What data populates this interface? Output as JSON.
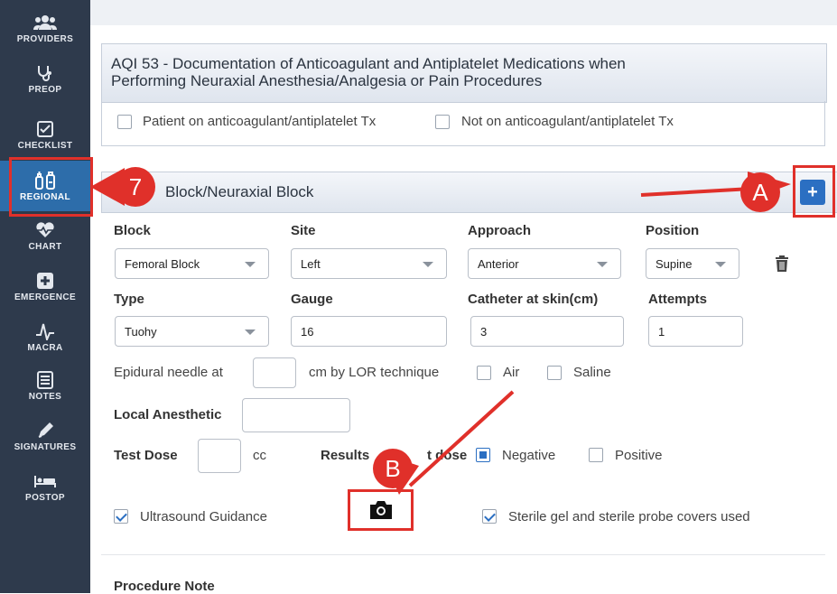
{
  "sidebar": {
    "items": [
      {
        "label": "PROVIDERS",
        "icon": "providers-icon"
      },
      {
        "label": "PREOP",
        "icon": "stethoscope-icon"
      },
      {
        "label": "CHECKLIST",
        "icon": "checklist-icon"
      },
      {
        "label": "REGIONAL",
        "icon": "regional-syringe-icon",
        "active": true
      },
      {
        "label": "CHART",
        "icon": "heart-pulse-icon"
      },
      {
        "label": "EMERGENCE",
        "icon": "medical-cross-icon"
      },
      {
        "label": "MACRA",
        "icon": "macra-waveform-icon"
      },
      {
        "label": "NOTES",
        "icon": "notes-icon"
      },
      {
        "label": "SIGNATURES",
        "icon": "pen-icon"
      },
      {
        "label": "POSTOP",
        "icon": "bed-icon"
      }
    ]
  },
  "aqi": {
    "title_line1": "AQI 53 - Documentation of Anticoagulant and Antiplatelet Medications when",
    "title_line2": "Performing Neuraxial Anesthesia/Analgesia or Pain Procedures",
    "option1": "Patient on anticoagulant/antiplatelet Tx",
    "option2": "Not on anticoagulant/antiplatelet Tx"
  },
  "block_panel": {
    "title": "Block/Neuraxial Block",
    "add_label": "+"
  },
  "fields": {
    "block_label": "Block",
    "block_value": "Femoral Block",
    "site_label": "Site",
    "site_value": "Left",
    "approach_label": "Approach",
    "approach_value": "Anterior",
    "position_label": "Position",
    "position_value": "Supine",
    "type_label": "Type",
    "type_value": "Tuohy",
    "gauge_label": "Gauge",
    "gauge_value": "16",
    "catheter_label": "Catheter at skin(cm)",
    "catheter_value": "3",
    "attempts_label": "Attempts",
    "attempts_value": "1"
  },
  "epidural": {
    "label_before": "Epidural needle at",
    "value": "",
    "label_after": "cm by LOR technique",
    "air": "Air",
    "saline": "Saline"
  },
  "local_anesthetic": {
    "label": "Local Anesthetic",
    "value": ""
  },
  "test_dose": {
    "label": "Test Dose",
    "value": "",
    "unit": "cc",
    "results_label_a": "Results",
    "results_label_b": "t dose",
    "negative": "Negative",
    "positive": "Positive"
  },
  "ultrasound": {
    "label": "Ultrasound Guidance"
  },
  "sterile": {
    "label": "Sterile gel and sterile probe covers used"
  },
  "procedure_note": {
    "label": "Procedure Note"
  },
  "annotations": {
    "step": "7",
    "a": "A",
    "b": "B"
  },
  "colors": {
    "sidebar": "#2e3a4c",
    "active": "#2d6daa",
    "annotation": "#e0302a",
    "accent": "#2b6fc2"
  }
}
